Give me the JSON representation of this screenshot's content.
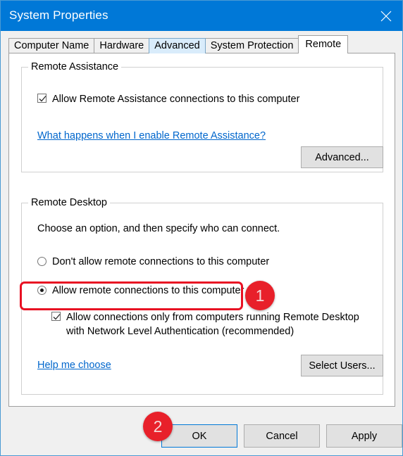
{
  "window": {
    "title": "System Properties",
    "close_icon": "close-icon",
    "accent_color": "#0078d7",
    "border_color": "#4a9ad4"
  },
  "tabs": [
    {
      "label": "Computer Name",
      "state": "normal"
    },
    {
      "label": "Hardware",
      "state": "normal"
    },
    {
      "label": "Advanced",
      "state": "hover"
    },
    {
      "label": "System Protection",
      "state": "normal"
    },
    {
      "label": "Remote",
      "state": "active"
    }
  ],
  "remote_assistance": {
    "group_title": "Remote Assistance",
    "allow_checkbox": {
      "label": "Allow Remote Assistance connections to this computer",
      "checked": true
    },
    "help_link": "What happens when I enable Remote Assistance?",
    "advanced_button": "Advanced..."
  },
  "remote_desktop": {
    "group_title": "Remote Desktop",
    "instruction": "Choose an option, and then specify who can connect.",
    "options": [
      {
        "label": "Don't allow remote connections to this computer",
        "selected": false
      },
      {
        "label": "Allow remote connections to this computer",
        "selected": true
      }
    ],
    "nla_checkbox": {
      "line1": "Allow connections only from computers running Remote Desktop",
      "line2": "with Network Level Authentication (recommended)",
      "checked": true
    },
    "help_link": "Help me choose",
    "select_users_button": "Select Users..."
  },
  "footer": {
    "ok_button": "OK",
    "cancel_button": "Cancel",
    "apply_button": "Apply"
  },
  "annotations": {
    "color": "#e8202a",
    "badge_1": "1",
    "badge_2": "2"
  }
}
